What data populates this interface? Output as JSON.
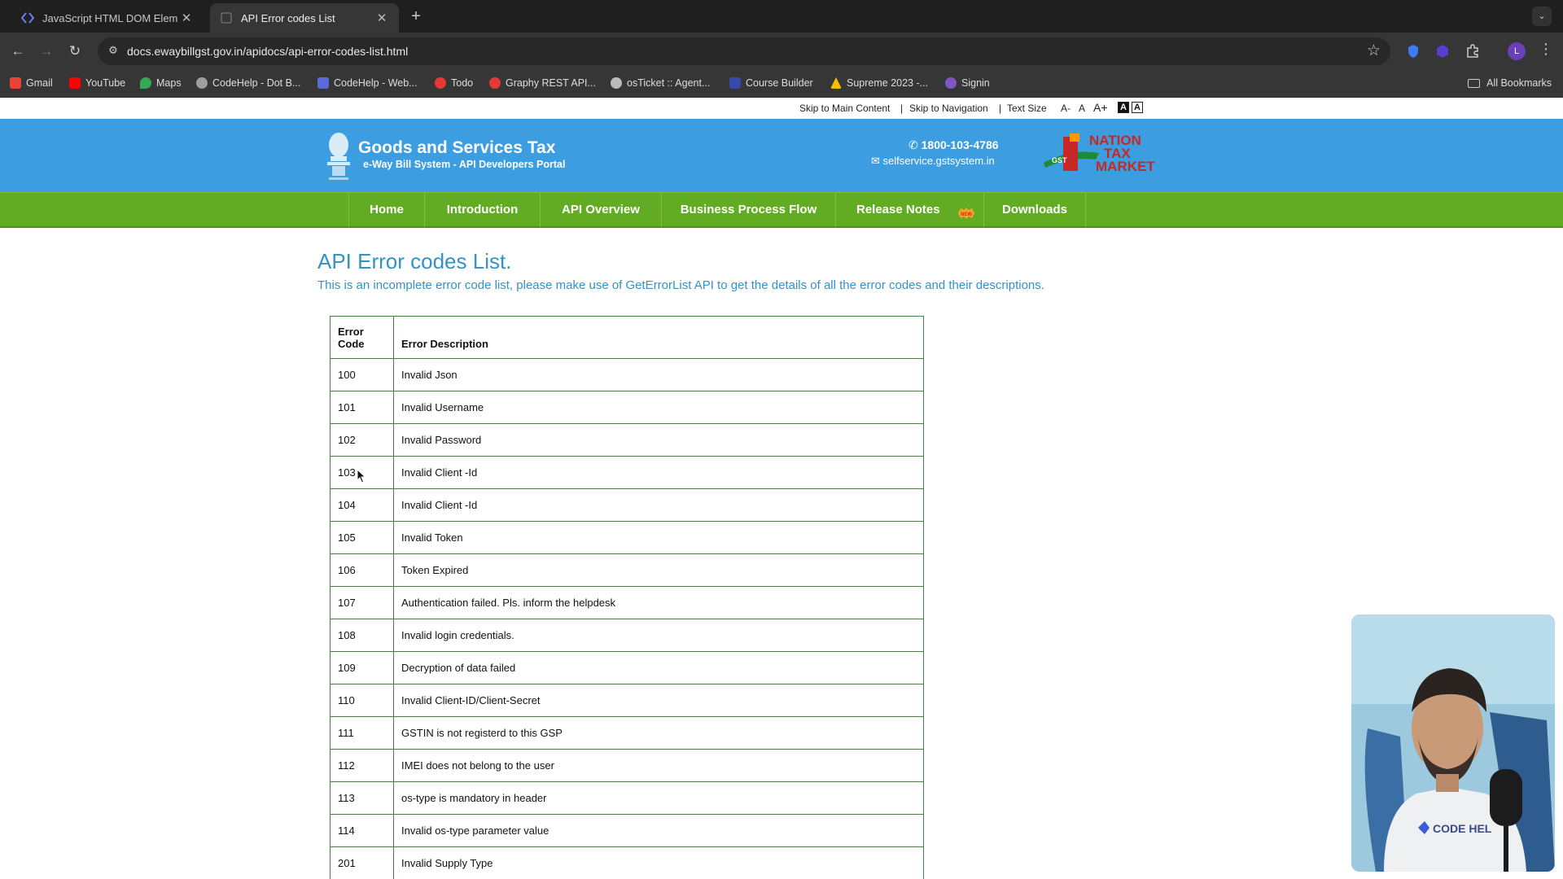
{
  "browser": {
    "tabs": [
      {
        "title": "JavaScript HTML DOM Elem",
        "active": false
      },
      {
        "title": "API Error codes List",
        "active": true
      }
    ],
    "url": "docs.ewaybillgst.gov.in/apidocs/api-error-codes-list.html",
    "profile_initial": "L",
    "bookmarks": [
      {
        "label": "Gmail",
        "icon": "gmail-icon",
        "color": "#ea4335"
      },
      {
        "label": "YouTube",
        "icon": "youtube-icon",
        "color": "#ff0000"
      },
      {
        "label": "Maps",
        "icon": "maps-icon",
        "color": "#34a853"
      },
      {
        "label": "CodeHelp - Dot B...",
        "icon": "globe-icon",
        "color": "#9e9e9e"
      },
      {
        "label": "CodeHelp - Web...",
        "icon": "codehelp-icon",
        "color": "#5b6bd6"
      },
      {
        "label": "Todo",
        "icon": "todo-icon",
        "color": "#e53935"
      },
      {
        "label": "Graphy REST API...",
        "icon": "graphy-icon",
        "color": "#e53935"
      },
      {
        "label": "osTicket :: Agent...",
        "icon": "osticket-icon",
        "color": "#bbbbbb"
      },
      {
        "label": "Course Builder",
        "icon": "course-icon",
        "color": "#3949ab"
      },
      {
        "label": "Supreme 2023 -...",
        "icon": "drive-icon",
        "color": "#fbbc04"
      },
      {
        "label": "Signin",
        "icon": "signin-icon",
        "color": "#7e57c2"
      }
    ],
    "all_bookmarks": "All Bookmarks"
  },
  "access_bar": {
    "skip_main": "Skip to Main Content",
    "sep": "|",
    "skip_nav": "Skip to Navigation",
    "text_size": "Text Size",
    "a_minus": "A-",
    "a_normal": "A",
    "a_plus": "A+",
    "contrast_dark": "A",
    "contrast_light": "A"
  },
  "header": {
    "title": "Goods and Services Tax",
    "subtitle": "e-Way Bill System - API Developers Portal",
    "phone": "1800-103-4786",
    "email": "selfservice.gstsystem.in",
    "logo_lines": [
      "NATION",
      "TAX",
      "MARKET"
    ],
    "logo_badge": "GST"
  },
  "nav": [
    {
      "label": "Home"
    },
    {
      "label": "Introduction"
    },
    {
      "label": "API Overview"
    },
    {
      "label": "Business Process Flow"
    },
    {
      "label": "Release Notes"
    },
    {
      "label": "Downloads"
    }
  ],
  "new_badge": "NEW",
  "content": {
    "title": "API Error codes List.",
    "note": "This is an incomplete error code list, please make use of GetErrorList API to get the details of all the error codes and their descriptions.",
    "table": {
      "headers": [
        "Error\nCode",
        "Error Description"
      ],
      "rows": [
        [
          "100",
          "Invalid Json"
        ],
        [
          "101",
          "Invalid Username"
        ],
        [
          "102",
          "Invalid Password"
        ],
        [
          "103",
          "Invalid Client -Id"
        ],
        [
          "104",
          "Invalid Client -Id"
        ],
        [
          "105",
          "Invalid Token"
        ],
        [
          "106",
          "Token Expired"
        ],
        [
          "107",
          "Authentication failed. Pls. inform the helpdesk"
        ],
        [
          "108",
          "Invalid login credentials."
        ],
        [
          "109",
          "Decryption of data failed"
        ],
        [
          "110",
          "Invalid Client-ID/Client-Secret"
        ],
        [
          "111",
          "GSTIN is not registerd to this GSP"
        ],
        [
          "112",
          "IMEI does not belong to the user"
        ],
        [
          "113",
          "os-type is mandatory in header"
        ],
        [
          "114",
          "Invalid os-type parameter value"
        ],
        [
          "201",
          "Invalid Supply Type"
        ]
      ]
    }
  },
  "webcam": {
    "shirt_text": "CODE HEL"
  },
  "colors": {
    "header_blue": "#3c9ee0",
    "nav_green": "#62ac24",
    "title_blue": "#3592c4",
    "table_border": "#4f7a4a"
  }
}
